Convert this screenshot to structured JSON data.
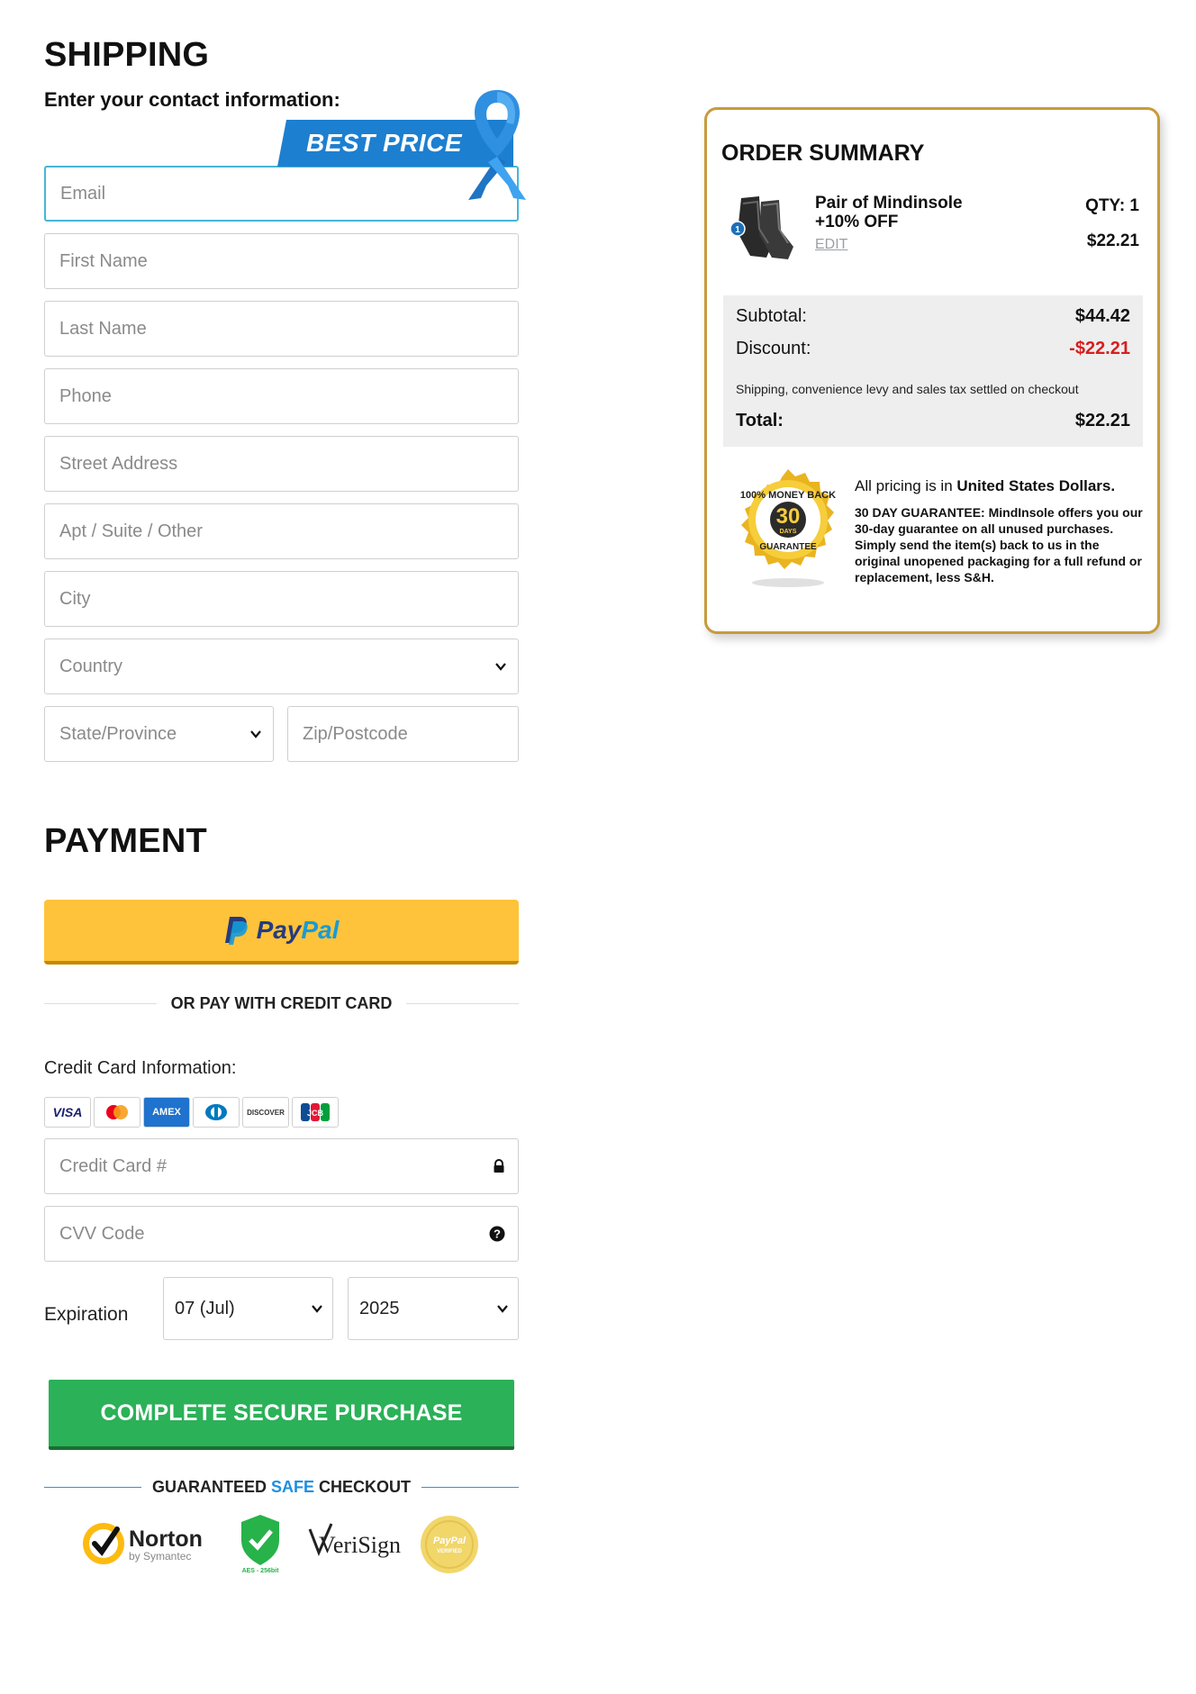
{
  "shipping": {
    "title": "SHIPPING",
    "subtitle": "Enter your contact information:",
    "badge": "BEST PRICE",
    "fields": {
      "email": "Email",
      "first_name": "First Name",
      "last_name": "Last Name",
      "phone": "Phone",
      "street": "Street Address",
      "apt": "Apt / Suite / Other",
      "city": "City",
      "country": "Country",
      "state": "State/Province",
      "zip": "Zip/Postcode"
    }
  },
  "payment": {
    "title": "PAYMENT",
    "paypal_pay": "Pay",
    "paypal_pal": "Pal",
    "or_credit": "OR PAY WITH CREDIT CARD",
    "cc_info_label": "Credit Card Information:",
    "cards": [
      "VISA",
      "mastercard",
      "AMEX",
      "diners",
      "DISCOVER",
      "JCB"
    ],
    "cc_number": "Credit Card #",
    "cvv": "CVV Code",
    "expiration_label": "Expiration",
    "exp_month": "07 (Jul)",
    "exp_year": "2025",
    "purchase_button": "COMPLETE SECURE PURCHASE",
    "guarantee_pre": "GUARANTEED ",
    "guarantee_safe": "SAFE",
    "guarantee_post": " CHECKOUT",
    "trust_badges": {
      "norton": "Norton",
      "norton_sub": "by Symantec",
      "aes": "AES - 256bit",
      "verisign": "VeriSign",
      "paypal_verified": "PayPal",
      "paypal_verified_sub": "VERIFIED"
    }
  },
  "summary": {
    "title": "ORDER SUMMARY",
    "product_name": "Pair of Mindinsole +10% OFF",
    "product_badge": "1",
    "edit": "EDIT",
    "qty": "QTY: 1",
    "line_price": "$22.21",
    "subtotal_label": "Subtotal:",
    "subtotal_value": "$44.42",
    "discount_label": "Discount:",
    "discount_value": "-$22.21",
    "note": "Shipping, convenience levy and sales tax settled on checkout",
    "total_label": "Total:",
    "total_value": "$22.21",
    "pricing_pre": "All pricing is in ",
    "pricing_bold": "United States Dollars.",
    "guarantee_text": "30 DAY GUARANTEE: MindInsole offers you our 30-day guarantee on all unused purchases. Simply send the item(s) back to us in the original unopened packaging for a full refund or replacement, less S&H.",
    "seal": {
      "top": "100% MONEY BACK",
      "number": "30",
      "days": "DAYS",
      "bottom": "GUARANTEE"
    }
  },
  "colors": {
    "paypal_yellow": "#fec33a",
    "purchase_green": "#2bb158",
    "discount_red": "#d81e1e",
    "summary_border": "#c89b3c",
    "focus_blue": "#45b7d8"
  }
}
